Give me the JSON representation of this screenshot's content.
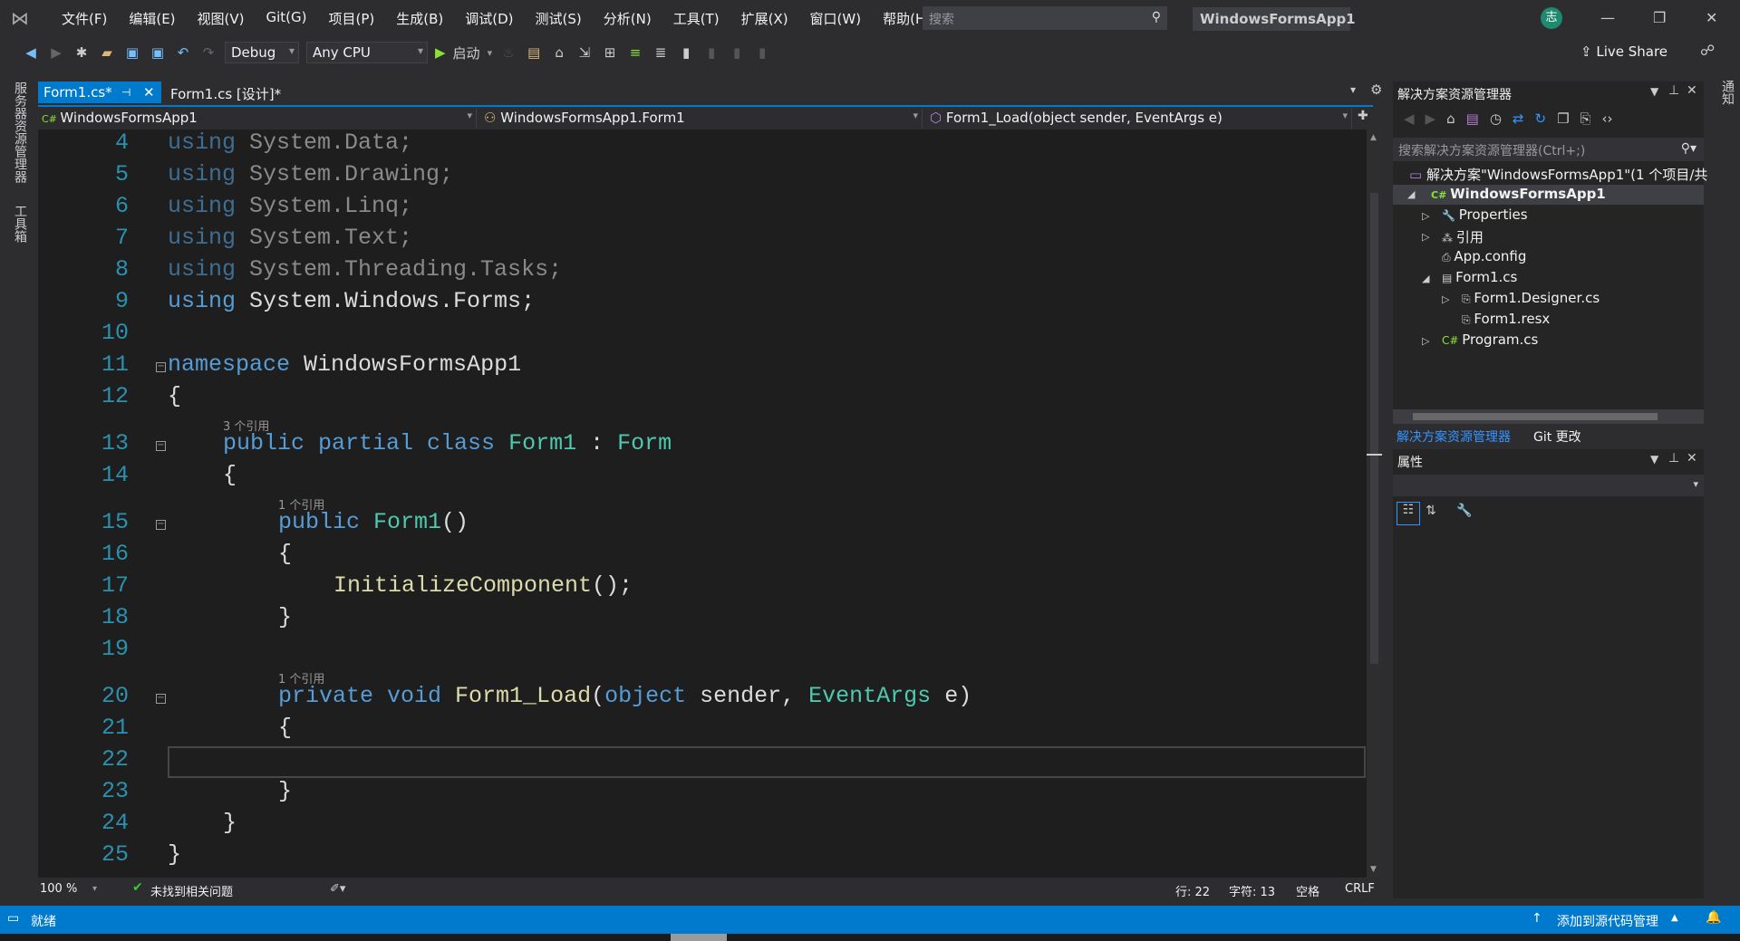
{
  "menu": {
    "items": [
      "文件(F)",
      "编辑(E)",
      "视图(V)",
      "Git(G)",
      "项目(P)",
      "生成(B)",
      "调试(D)",
      "测试(S)",
      "分析(N)",
      "工具(T)",
      "扩展(X)",
      "窗口(W)",
      "帮助(H)"
    ],
    "search_placeholder": "搜索",
    "window_title": "WindowsFormsApp1",
    "avatar": "志"
  },
  "toolbar": {
    "config": "Debug",
    "platform": "Any CPU",
    "start": "启动",
    "live_share": "Live Share"
  },
  "left_strip": {
    "server_explorer": "服务器资源管理器",
    "toolbox": "工具箱"
  },
  "right_strip": {
    "notifications": "通知"
  },
  "tabs": [
    {
      "label": "Form1.cs*",
      "active": true
    },
    {
      "label": "Form1.cs [设计]*",
      "active": false
    }
  ],
  "nav": {
    "project": "WindowsFormsApp1",
    "type": "WindowsFormsApp1.Form1",
    "member": "Form1_Load(object sender, EventArgs e)"
  },
  "code": {
    "current_line": 22,
    "lines": [
      {
        "n": 4,
        "tokens": [
          [
            "using ",
            "dim-keyword"
          ],
          [
            "System.Data;",
            "dim"
          ]
        ]
      },
      {
        "n": 5,
        "tokens": [
          [
            "using ",
            "dim-keyword"
          ],
          [
            "System.Drawing;",
            "dim"
          ]
        ]
      },
      {
        "n": 6,
        "tokens": [
          [
            "using ",
            "dim-keyword"
          ],
          [
            "System.Linq;",
            "dim"
          ]
        ]
      },
      {
        "n": 7,
        "tokens": [
          [
            "using ",
            "dim-keyword"
          ],
          [
            "System.Text;",
            "dim"
          ]
        ]
      },
      {
        "n": 8,
        "tokens": [
          [
            "using ",
            "dim-keyword"
          ],
          [
            "System.Threading.Tasks;",
            "dim"
          ]
        ]
      },
      {
        "n": 9,
        "tokens": [
          [
            "using ",
            "keyword"
          ],
          [
            "System.Windows.Forms;",
            "plain"
          ]
        ]
      },
      {
        "n": 10,
        "tokens": []
      },
      {
        "n": 11,
        "fold": true,
        "tokens": [
          [
            "namespace ",
            "keyword"
          ],
          [
            "WindowsFormsApp1",
            "plain"
          ]
        ]
      },
      {
        "n": 12,
        "tokens": [
          [
            "{",
            "plain"
          ]
        ]
      },
      {
        "n": 13,
        "fold": true,
        "indent": 1,
        "lens": "3 个引用",
        "tokens": [
          [
            "public partial class ",
            "keyword"
          ],
          [
            "Form1",
            "type"
          ],
          [
            " : ",
            "plain"
          ],
          [
            "Form",
            "type"
          ]
        ]
      },
      {
        "n": 14,
        "indent": 1,
        "tokens": [
          [
            "{",
            "plain"
          ]
        ]
      },
      {
        "n": 15,
        "fold": true,
        "indent": 2,
        "lens": "1 个引用",
        "tokens": [
          [
            "public ",
            "keyword"
          ],
          [
            "Form1",
            "type"
          ],
          [
            "()",
            "plain"
          ]
        ]
      },
      {
        "n": 16,
        "indent": 2,
        "tokens": [
          [
            "{",
            "plain"
          ]
        ]
      },
      {
        "n": 17,
        "indent": 3,
        "tokens": [
          [
            "InitializeComponent",
            "method"
          ],
          [
            "();",
            "plain"
          ]
        ]
      },
      {
        "n": 18,
        "indent": 2,
        "tokens": [
          [
            "}",
            "plain"
          ]
        ]
      },
      {
        "n": 19,
        "tokens": []
      },
      {
        "n": 20,
        "fold": true,
        "indent": 2,
        "lens": "1 个引用",
        "tokens": [
          [
            "private void ",
            "keyword"
          ],
          [
            "Form1_Load",
            "method"
          ],
          [
            "(",
            "plain"
          ],
          [
            "object ",
            "keyword"
          ],
          [
            "sender, ",
            "plain"
          ],
          [
            "EventArgs ",
            "type"
          ],
          [
            "e)",
            "plain"
          ]
        ]
      },
      {
        "n": 21,
        "indent": 2,
        "tokens": [
          [
            "{",
            "plain"
          ]
        ]
      },
      {
        "n": 22,
        "indent": 2,
        "tokens": []
      },
      {
        "n": 23,
        "indent": 2,
        "tokens": [
          [
            "}",
            "plain"
          ]
        ]
      },
      {
        "n": 24,
        "indent": 1,
        "tokens": [
          [
            "}",
            "plain"
          ]
        ]
      },
      {
        "n": 25,
        "tokens": [
          [
            "}",
            "plain"
          ]
        ]
      }
    ]
  },
  "editor_status": {
    "zoom": "100 %",
    "issues": "未找到相关问题",
    "line": "行: 22",
    "char": "字符: 13",
    "spaces": "空格",
    "eol": "CRLF"
  },
  "solution_explorer": {
    "title": "解决方案资源管理器",
    "search_placeholder": "搜索解决方案资源管理器(Ctrl+;)",
    "solution": "解决方案\"WindowsFormsApp1\"(1 个项目/共",
    "project": "WindowsFormsApp1",
    "items": [
      {
        "label": "Properties",
        "depth": 1,
        "expander": "collapsed",
        "icon": "wrench-icon"
      },
      {
        "label": "引用",
        "depth": 1,
        "expander": "collapsed",
        "icon": "references-icon"
      },
      {
        "label": "App.config",
        "depth": 1,
        "expander": "none",
        "icon": "config-file-icon"
      },
      {
        "label": "Form1.cs",
        "depth": 1,
        "expander": "expanded",
        "icon": "form-icon"
      },
      {
        "label": "Form1.Designer.cs",
        "depth": 2,
        "expander": "collapsed",
        "icon": "file-icon"
      },
      {
        "label": "Form1.resx",
        "depth": 2,
        "expander": "none",
        "icon": "file-icon"
      },
      {
        "label": "Program.cs",
        "depth": 1,
        "expander": "collapsed",
        "icon": "csharp-icon"
      }
    ],
    "bottom_tabs": [
      "解决方案资源管理器",
      "Git 更改"
    ]
  },
  "properties": {
    "title": "属性"
  },
  "statusbar": {
    "ready": "就绪",
    "source_control": "添加到源代码管理"
  },
  "colors": {
    "accent": "#007acc",
    "editor_bg": "#1e1e1e",
    "keyword": "#569cd6",
    "type": "#4ec9b0",
    "method": "#dcdcaa"
  }
}
